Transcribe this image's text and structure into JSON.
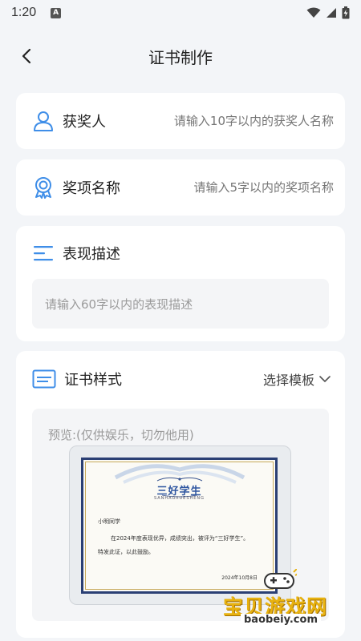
{
  "status_bar": {
    "time": "1:20",
    "notification_badge": "A"
  },
  "header": {
    "title": "证书制作"
  },
  "recipient": {
    "label": "获奖人",
    "placeholder": "请输入10字以内的获奖人名称",
    "value": ""
  },
  "award": {
    "label": "奖项名称",
    "placeholder": "请输入5字以内的奖项名称",
    "value": ""
  },
  "description": {
    "label": "表现描述",
    "placeholder": "请输入60字以内的表现描述",
    "value": ""
  },
  "certificate_style": {
    "label": "证书样式",
    "choose_label": "选择模板",
    "preview_note": "预览:(仅供娱乐，切勿他用)",
    "sample": {
      "title": "三好学生",
      "subtitle": "SANHAOXUESHENG",
      "name": "小明同学",
      "body": "在2024年度表现优异，成绩突出，被评为“三好学生”。",
      "special": "特发此证，以此鼓励。",
      "date": "2024年10月8日"
    }
  },
  "watermark": {
    "title": "宝贝游戏网",
    "url": "baobeiy.com"
  },
  "colors": {
    "accent": "#3f8ee8",
    "background": "#f3f5f8",
    "cert_border": "#2a3f74",
    "cert_title": "#2e55a0",
    "watermark": "#e8b20f"
  }
}
